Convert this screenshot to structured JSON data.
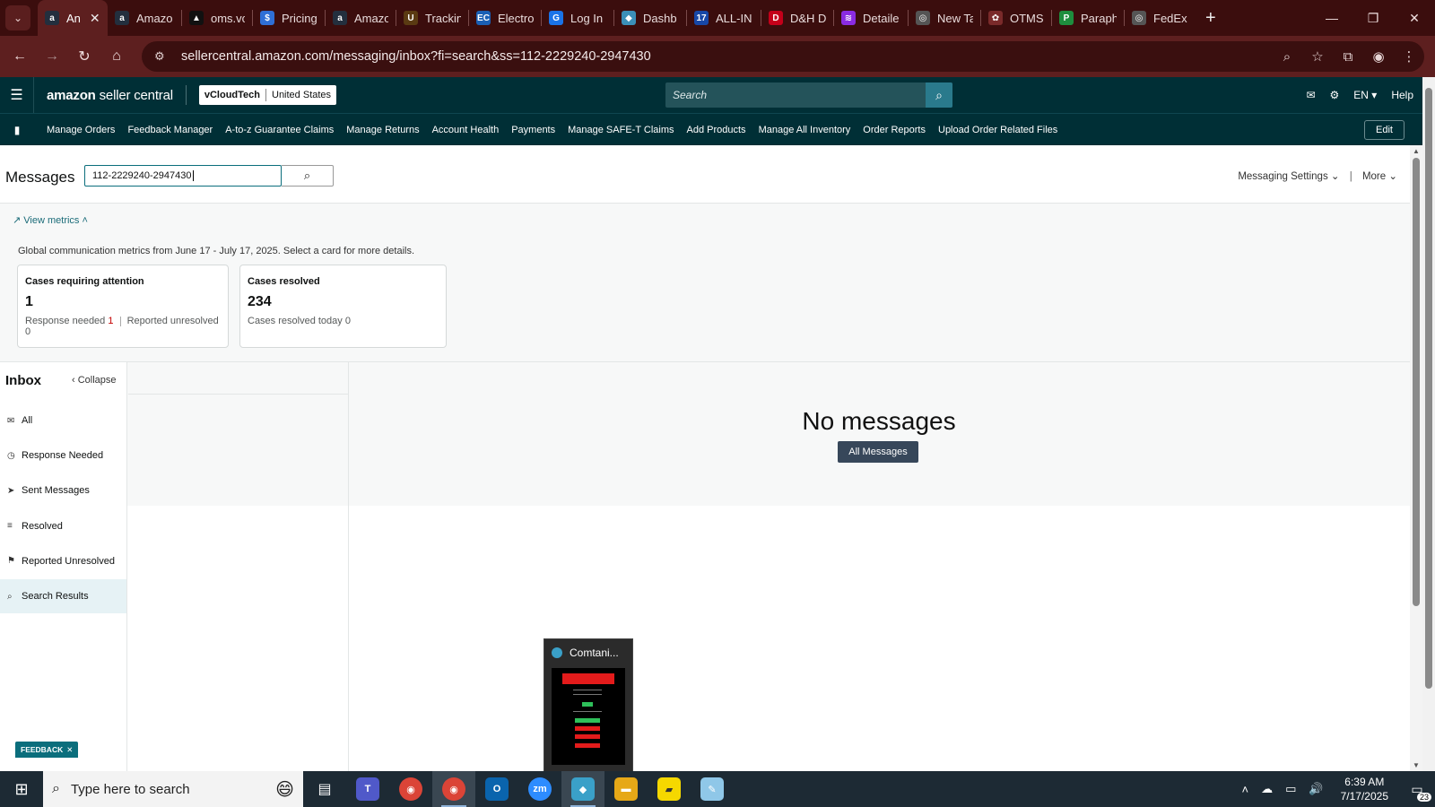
{
  "browser": {
    "tabs": [
      {
        "label": "An",
        "icon": "amazon-icon",
        "color": "#232f3e",
        "glyph": "a",
        "active": true
      },
      {
        "label": "Amazo",
        "icon": "amazon-icon",
        "color": "#232f3e",
        "glyph": "a"
      },
      {
        "label": "oms.vc",
        "icon": "oms-icon",
        "color": "#111111",
        "glyph": "▲"
      },
      {
        "label": "Pricing",
        "icon": "pricing-icon",
        "color": "#2f6fd6",
        "glyph": "$"
      },
      {
        "label": "Amazo",
        "icon": "amazon-icon",
        "color": "#232f3e",
        "glyph": "a"
      },
      {
        "label": "Trackin",
        "icon": "ups-icon",
        "color": "#5a3a12",
        "glyph": "U"
      },
      {
        "label": "Electro",
        "icon": "ec-icon",
        "color": "#1a5fb4",
        "glyph": "EC"
      },
      {
        "label": "Log In",
        "icon": "login-icon",
        "color": "#1a73e8",
        "glyph": "G"
      },
      {
        "label": "Dashb",
        "icon": "dashboard-icon",
        "color": "#3b8fb8",
        "glyph": "◆"
      },
      {
        "label": "ALL-IN",
        "icon": "allin-icon",
        "color": "#1747a6",
        "glyph": "17"
      },
      {
        "label": "D&H D",
        "icon": "dh-icon",
        "color": "#c4001a",
        "glyph": "D"
      },
      {
        "label": "Detaile",
        "icon": "detail-icon",
        "color": "#8a2be2",
        "glyph": "≋"
      },
      {
        "label": "New Ta",
        "icon": "chrome-icon",
        "color": "#555555",
        "glyph": "◎"
      },
      {
        "label": "OTMS",
        "icon": "otms-icon",
        "color": "#7a2a2a",
        "glyph": "✿"
      },
      {
        "label": "Paraph",
        "icon": "paraph-icon",
        "color": "#1e8e3e",
        "glyph": "P"
      },
      {
        "label": "FedEx",
        "icon": "fedex-icon",
        "color": "#555555",
        "glyph": "◎"
      }
    ],
    "url": "sellercentral.amazon.com/messaging/inbox?fi=search&ss=112-2229240-2947430"
  },
  "header": {
    "logo_bold": "amazon",
    "logo_light": "seller central",
    "account_name": "vCloudTech",
    "account_region": "United States",
    "search_placeholder": "Search",
    "lang": "EN",
    "help": "Help"
  },
  "nav": {
    "links": [
      "Manage Orders",
      "Feedback Manager",
      "A-to-z Guarantee Claims",
      "Manage Returns",
      "Account Health",
      "Payments",
      "Manage SAFE-T Claims",
      "Add Products",
      "Manage All Inventory",
      "Order Reports",
      "Upload Order Related Files"
    ],
    "edit": "Edit"
  },
  "messages": {
    "title": "Messages",
    "search_value": "112-2229240-2947430",
    "settings": "Messaging Settings",
    "more": "More",
    "view_metrics": "View metrics",
    "metrics_note": "Global communication metrics from June 17 - July 17, 2025. Select a card for more details.",
    "cards": {
      "attention": {
        "title": "Cases requiring attention",
        "value": "1",
        "sub_a_label": "Response needed",
        "sub_a_value": "1",
        "sub_b_label": "Reported unresolved",
        "sub_b_value": "0"
      },
      "resolved": {
        "title": "Cases resolved",
        "value": "234",
        "sub_label": "Cases resolved today",
        "sub_value": "0"
      }
    },
    "inbox": {
      "title": "Inbox",
      "collapse": "Collapse",
      "items": [
        {
          "label": "All",
          "icon": "mail-icon"
        },
        {
          "label": "Response Needed",
          "icon": "clock-icon"
        },
        {
          "label": "Sent Messages",
          "icon": "send-icon"
        },
        {
          "label": "Resolved",
          "icon": "resolved-icon"
        },
        {
          "label": "Reported Unresolved",
          "icon": "report-icon"
        },
        {
          "label": "Search Results",
          "icon": "search-icon",
          "selected": true
        }
      ]
    },
    "empty_title": "No messages",
    "all_messages_button": "All Messages",
    "feedback": "FEEDBACK"
  },
  "popup": {
    "title": "Comtani..."
  },
  "taskbar": {
    "search_placeholder": "Type here to search",
    "time": "6:39 AM",
    "date": "7/17/2025",
    "notifications": "23"
  }
}
